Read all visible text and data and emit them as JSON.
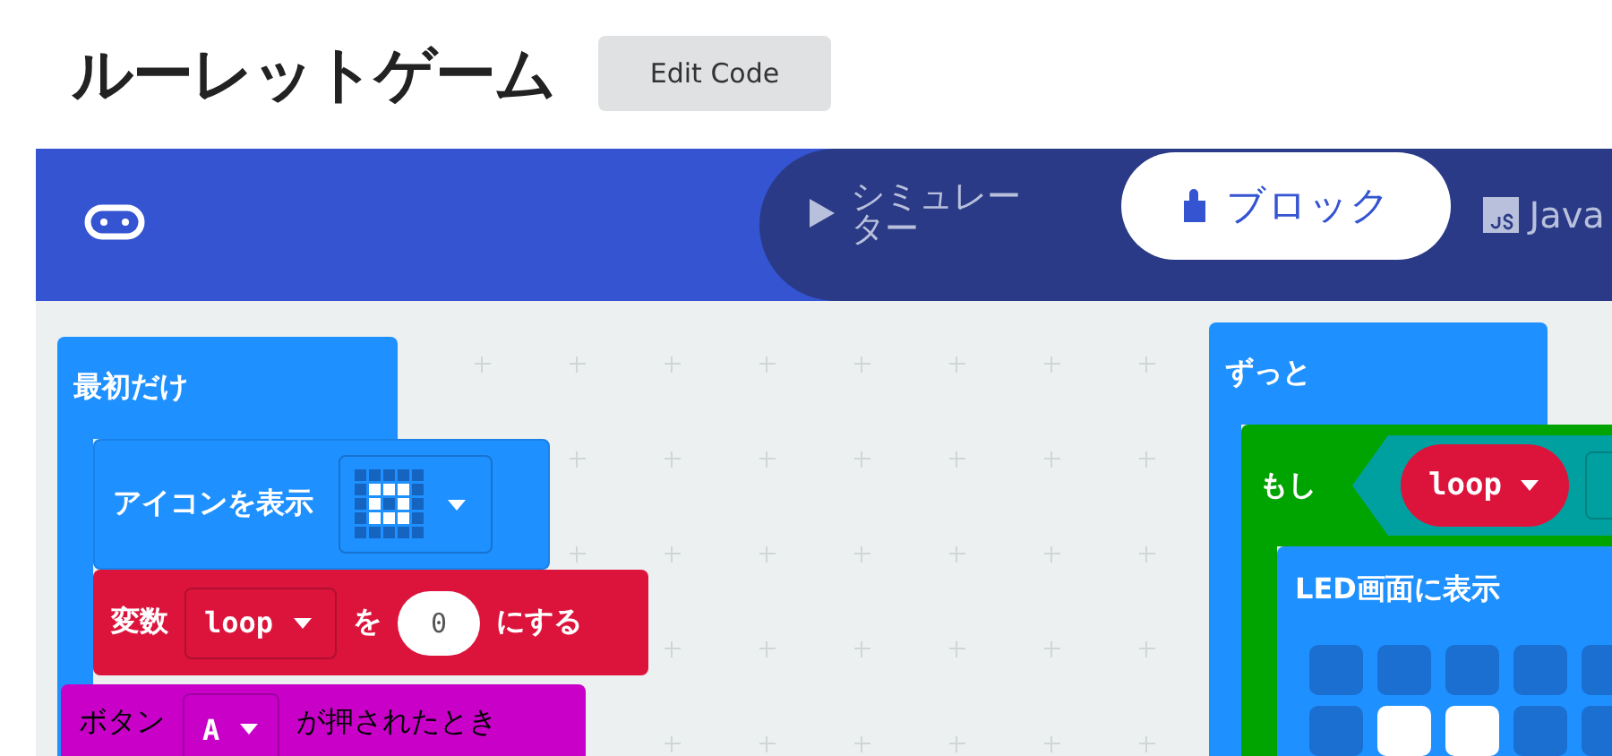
{
  "page_title": "ルーレットゲーム",
  "edit_button": "Edit Code",
  "editor_tabs": [
    {
      "kind": "simulator",
      "label": "シミュレーター",
      "selected": false
    },
    {
      "kind": "blocks",
      "label": "ブロック",
      "selected": true
    },
    {
      "kind": "javascript",
      "label": "Java",
      "selected": false
    }
  ],
  "blocks": [
    {
      "kind": "on_start",
      "label": "最初だけ",
      "children": [
        {
          "kind": "show_icon",
          "label": "アイコンを表示"
        },
        {
          "kind": "set_variable",
          "label": "変数",
          "variable": "loop",
          "word": "を",
          "value": "0",
          "tail": "にする"
        }
      ]
    },
    {
      "kind": "on_button",
      "label": "ボタン",
      "button": "A",
      "tail": "が押されたとき"
    },
    {
      "kind": "forever",
      "label": "ずっと",
      "children": [
        {
          "kind": "if",
          "label": "もし",
          "condition": {
            "variable": "loop"
          },
          "children": [
            {
              "kind": "show_leds",
              "label": "LED画面に表示",
              "leds": [
                [
                  {
                    "on": false
                  },
                  {
                    "on": false
                  },
                  {
                    "on": false
                  },
                  {
                    "on": false
                  },
                  {
                    "on": false
                  }
                ],
                [
                  {
                    "on": false
                  },
                  {
                    "on": true
                  },
                  {
                    "on": true
                  },
                  {
                    "on": false
                  },
                  {
                    "on": false
                  }
                ]
              ]
            }
          ]
        }
      ]
    }
  ]
}
